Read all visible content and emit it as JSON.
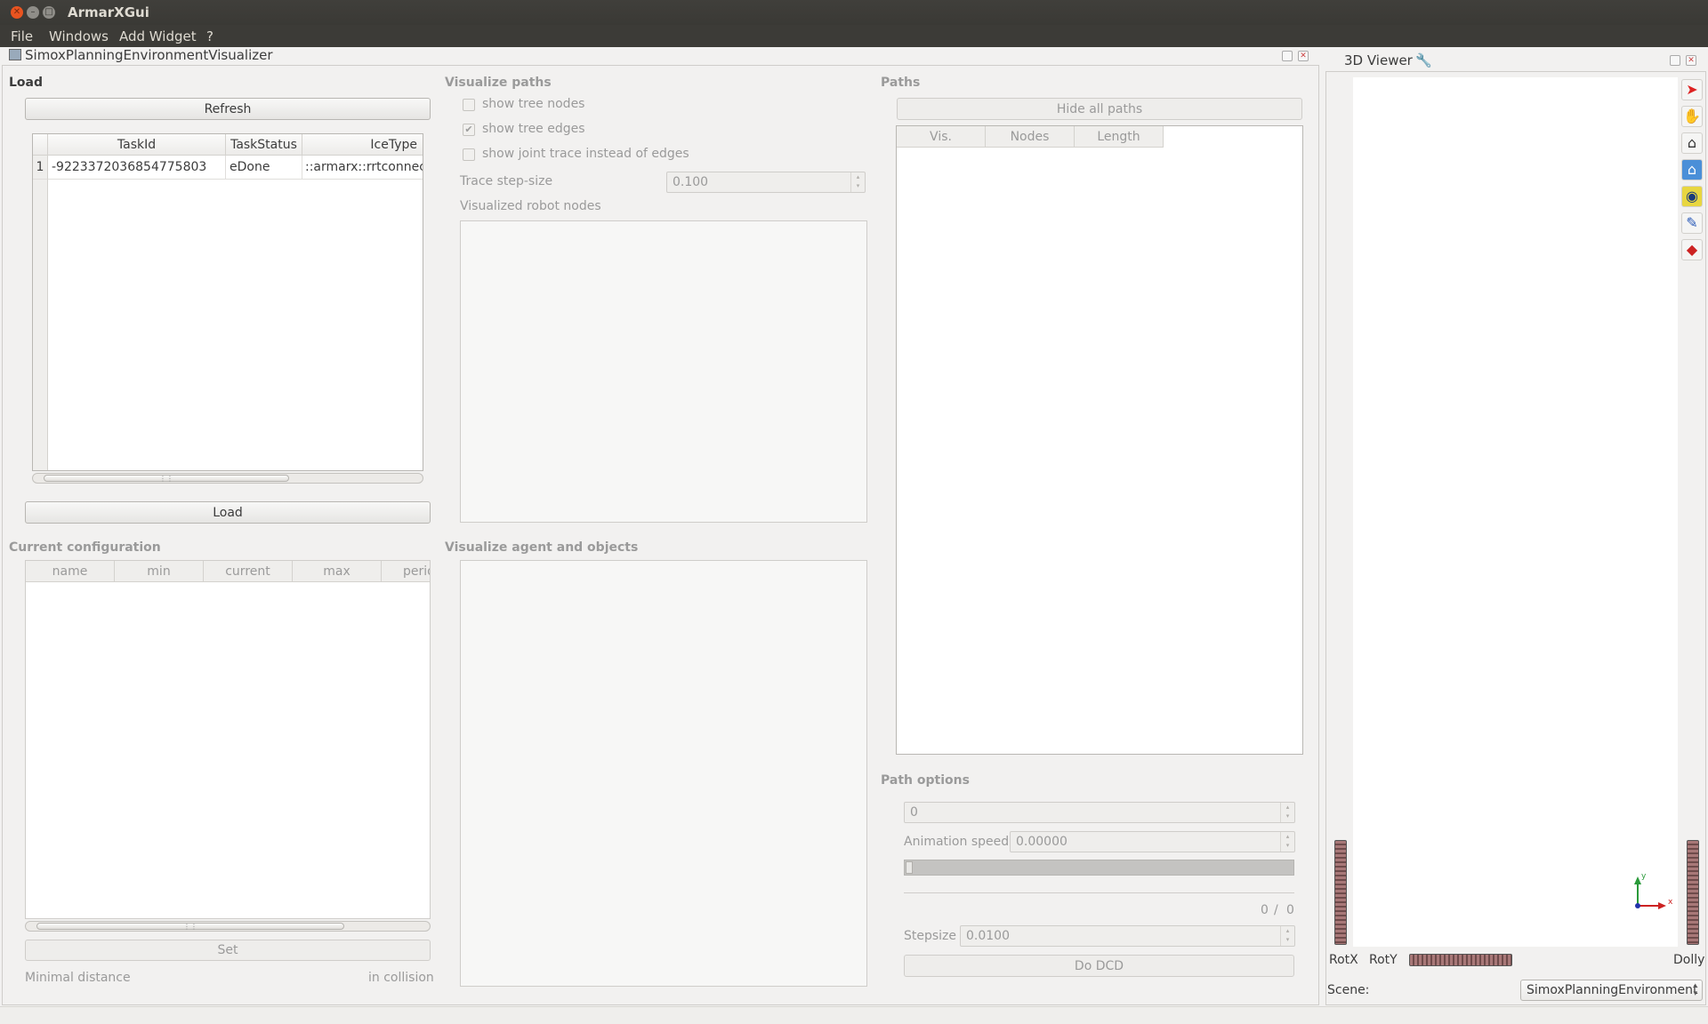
{
  "window": {
    "title": "ArmarXGui"
  },
  "menu": {
    "file": "File",
    "windows": "Windows",
    "add_widget": "Add Widget",
    "help": "?"
  },
  "widget": {
    "title": "SimoxPlanningEnvironmentVisualizer"
  },
  "load": {
    "title": "Load",
    "refresh_label": "Refresh",
    "load_label": "Load",
    "columns": [
      "TaskId",
      "TaskStatus",
      "IceType"
    ],
    "rows": [
      {
        "index": "1",
        "task_id": "-9223372036854775803",
        "task_status": "eDone",
        "ice_type": "::armarx::rrtconnect"
      }
    ]
  },
  "visualize_paths": {
    "title": "Visualize paths",
    "show_tree_nodes": {
      "label": "show tree nodes",
      "checked": false
    },
    "show_tree_edges": {
      "label": "show tree edges",
      "checked": true
    },
    "show_joint_trace": {
      "label": "show joint trace instead of edges",
      "checked": false
    },
    "trace_step_size_label": "Trace step-size",
    "trace_step_size_value": "0.100",
    "robot_nodes_label": "Visualized robot nodes"
  },
  "paths": {
    "title": "Paths",
    "hide_all_label": "Hide all paths",
    "columns": [
      "Vis.",
      "Nodes",
      "Length"
    ]
  },
  "current_config": {
    "title": "Current configuration",
    "columns": [
      "name",
      "min",
      "current",
      "max",
      "perio"
    ],
    "set_label": "Set",
    "min_distance_label": "Minimal distance",
    "collision_label": "in collision"
  },
  "visualize_agent": {
    "title": "Visualize agent and objects"
  },
  "path_options": {
    "title": "Path options",
    "path_index_value": "0",
    "animation_speed_label": "Animation speed",
    "animation_speed_value": "0.00000",
    "progress_current": "0",
    "progress_sep": "/",
    "progress_total": "0",
    "stepsize_label": "Stepsize",
    "stepsize_value": "0.0100",
    "do_dcd_label": "Do DCD"
  },
  "viewer": {
    "title": "3D Viewer",
    "rotx_label": "RotX",
    "roty_label": "RotY",
    "dolly_label": "Dolly",
    "scene_label": "Scene:",
    "scene_value": "SimoxPlanningEnvironment",
    "axis_x": "x",
    "axis_y": "y",
    "tools": [
      "select-arrow-icon",
      "hand-pan-icon",
      "home-icon",
      "set-home-icon",
      "view-all-icon",
      "seek-icon",
      "perspective-icon"
    ]
  },
  "colors": {
    "titlebar": "#3c3b37",
    "close": "#e95420",
    "background": "#f2f1f0"
  }
}
